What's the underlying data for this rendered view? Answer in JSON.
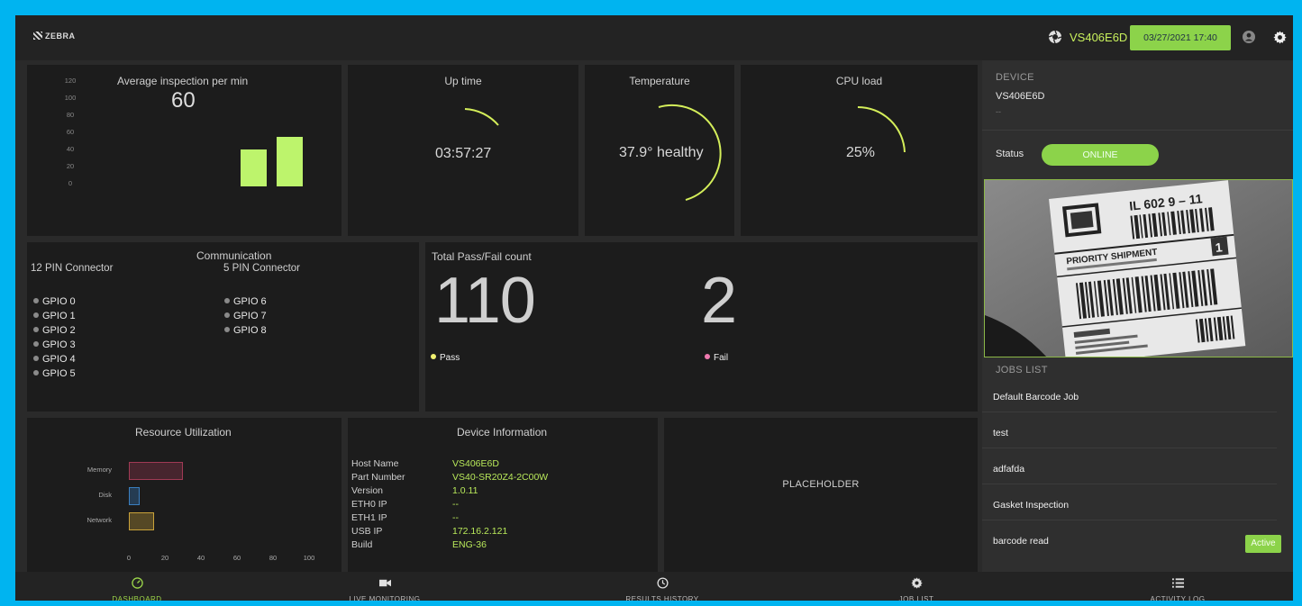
{
  "header": {
    "brand": "ZEBRA",
    "device_name": "VS406E6D",
    "datetime": "03/27/2021 17:40"
  },
  "avg_inspection": {
    "title": "Average inspection per min",
    "value": "60",
    "yticks": [
      "120",
      "100",
      "80",
      "60",
      "40",
      "20",
      "0"
    ]
  },
  "chart_data": [
    {
      "type": "bar",
      "title": "Average inspection per min",
      "categories": [
        "",
        ""
      ],
      "values": [
        43,
        58
      ],
      "ylim": [
        0,
        130
      ],
      "grid": false,
      "color": "#bdf46c"
    },
    {
      "type": "bar",
      "title": "Resource Utilization",
      "orientation": "horizontal",
      "categories": [
        "Memory",
        "Disk",
        "Network"
      ],
      "values": [
        30,
        6,
        14
      ],
      "xlim": [
        0,
        100
      ],
      "xticks": [
        "0",
        "20",
        "40",
        "60",
        "80",
        "100"
      ],
      "colors": [
        "#a03a55",
        "#3a7fc0",
        "#c9a23a"
      ]
    }
  ],
  "uptime": {
    "title": "Up time",
    "value": "03:57:27",
    "fraction": 0.2
  },
  "temperature": {
    "title": "Temperature",
    "value": "37.9° healthy",
    "fraction": 0.5
  },
  "cpu": {
    "title": "CPU load",
    "value": "25%",
    "fraction": 0.25
  },
  "communication": {
    "title": "Communication",
    "pin12": {
      "title": "12 PIN Connector",
      "items": [
        "GPIO 0",
        "GPIO 1",
        "GPIO 2",
        "GPIO 3",
        "GPIO 4",
        "GPIO 5"
      ]
    },
    "pin5": {
      "title": "5 PIN Connector",
      "items": [
        "GPIO 6",
        "GPIO 7",
        "GPIO 8"
      ]
    }
  },
  "passfail": {
    "title": "Total Pass/Fail count",
    "pass_count": "110",
    "fail_count": "2",
    "pass_label": "Pass",
    "fail_label": "Fail",
    "pass_color": "#f0f070",
    "fail_color": "#f07ab0"
  },
  "resource": {
    "title": "Resource Utilization"
  },
  "device_info": {
    "title": "Device Information",
    "rows": [
      {
        "key": "Host Name",
        "value": "VS406E6D"
      },
      {
        "key": "Part Number",
        "value": "VS40-SR20Z4-2C00W"
      },
      {
        "key": "Version",
        "value": "1.0.11"
      },
      {
        "key": "ETH0 IP",
        "value": "--"
      },
      {
        "key": "ETH1 IP",
        "value": "--"
      },
      {
        "key": "USB IP",
        "value": "172.16.2.121"
      },
      {
        "key": "Build",
        "value": "ENG-36"
      }
    ]
  },
  "placeholder": {
    "label": "PLACEHOLDER"
  },
  "side": {
    "device_heading": "DEVICE",
    "device_name": "VS406E6D",
    "device_sub": "--",
    "status_label": "Status",
    "status_value": "ONLINE",
    "camera": {
      "label_code": "IL 602 9 – 11",
      "label_title": "PRIORITY SHIPMENT",
      "label_num": "1"
    },
    "jobs_heading": "JOBS LIST",
    "jobs": [
      {
        "name": "Default Barcode Job"
      },
      {
        "name": "test"
      },
      {
        "name": "adfafda"
      },
      {
        "name": "Gasket Inspection"
      },
      {
        "name": "barcode read",
        "badge": "Active"
      }
    ]
  },
  "bottom_nav": [
    {
      "label": "DASHBOARD",
      "icon": "speedometer-icon",
      "active": true
    },
    {
      "label": "LIVE MONITORING",
      "icon": "video-camera-icon"
    },
    {
      "label": "RESULTS HISTORY",
      "icon": "history-icon"
    },
    {
      "label": "JOB LIST",
      "icon": "gear-icon"
    },
    {
      "label": "ACTIVITY LOG",
      "icon": "list-icon"
    }
  ],
  "colors": {
    "accent": "#8cd34a",
    "bar": "#bdf46c",
    "text_green": "#b8e85a"
  }
}
